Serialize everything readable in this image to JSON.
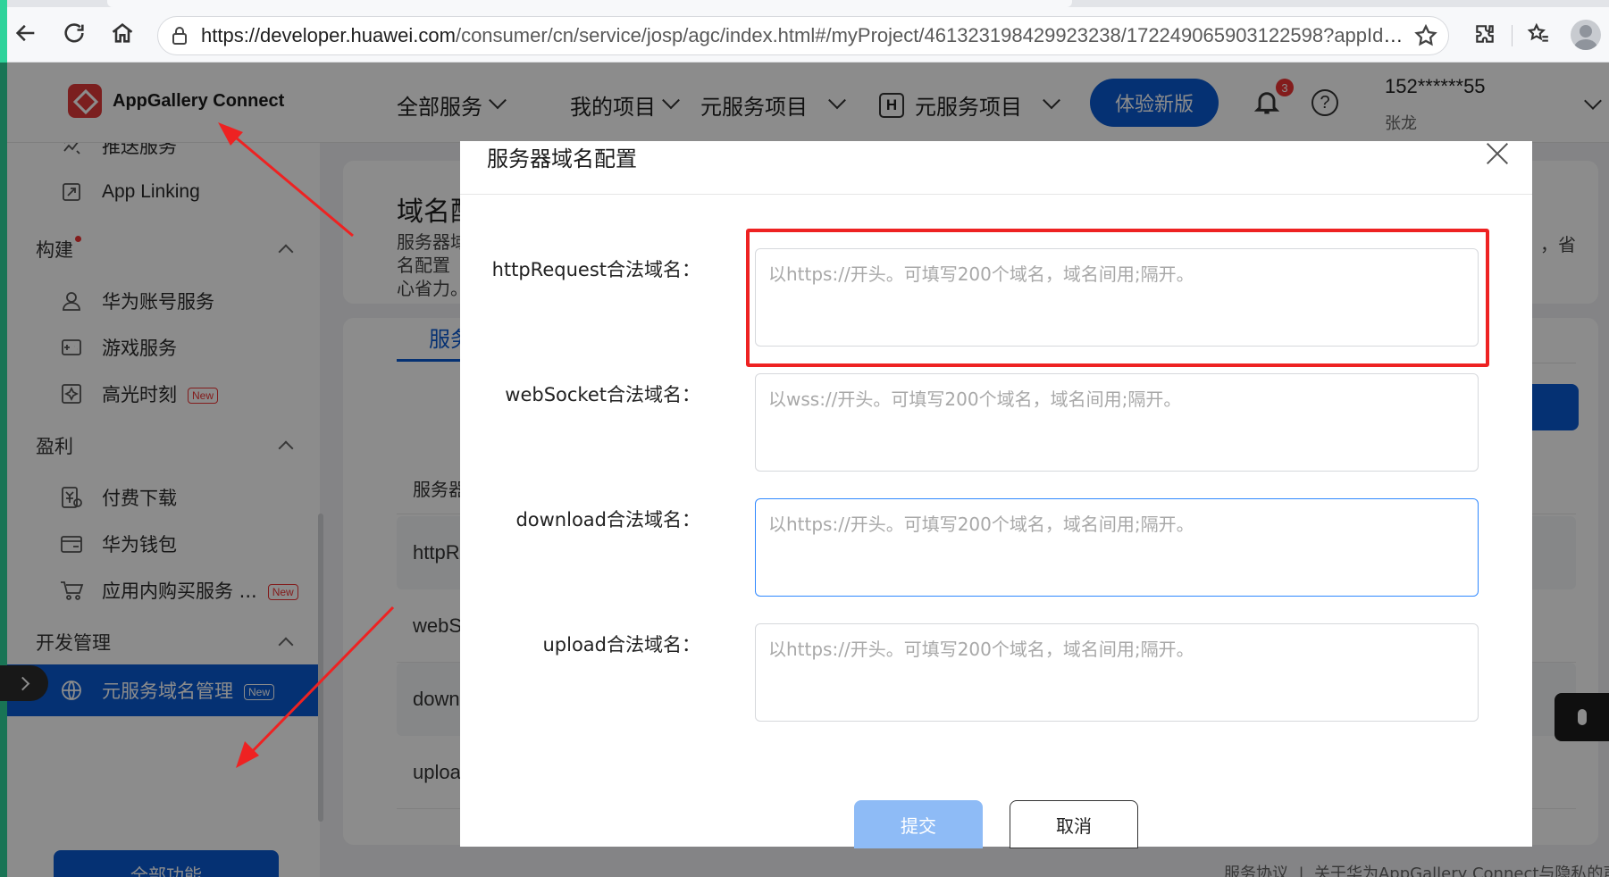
{
  "browser": {
    "url_host": "https://developer.huawei.com",
    "url_path": "/consumer/cn/service/josp/agc/index.html#/myProject/461323198429923238/172249065903122598?appId=6917..."
  },
  "header": {
    "logo_text": "AppGallery Connect",
    "nav": {
      "all_services": "全部服务",
      "my_projects": "我的项目",
      "atomic_projects": "元服务项目",
      "h_box": "H",
      "atomic_projects_2": "元服务项目"
    },
    "try_new": "体验新版",
    "notification_count": "3",
    "help": "?",
    "user_phone": "152******55",
    "user_name": "张龙"
  },
  "sidebar": {
    "items_top": [
      {
        "label": "推送服务",
        "icon": "push-icon"
      },
      {
        "label": "App Linking",
        "icon": "link-icon"
      }
    ],
    "group_build": "构建",
    "items_build": [
      {
        "label": "华为账号服务",
        "icon": "user-icon"
      },
      {
        "label": "游戏服务",
        "icon": "game-icon"
      },
      {
        "label": "高光时刻",
        "icon": "sparkle-icon",
        "badge": "New"
      }
    ],
    "group_profit": "盈利",
    "items_profit": [
      {
        "label": "付费下载",
        "icon": "paid-download-icon"
      },
      {
        "label": "华为钱包",
        "icon": "wallet-icon"
      },
      {
        "label": "应用内购买服务 ...",
        "icon": "cart-icon",
        "badge": "New"
      }
    ],
    "group_dev": "开发管理",
    "active_item": {
      "label": "元服务域名管理",
      "icon": "www-icon",
      "badge": "New"
    },
    "all_functions": "全部功能"
  },
  "main": {
    "title": "域名配",
    "desc": "服务器域名配置 心省力。",
    "desc_right": "，省",
    "tab": "服务",
    "table_head": "服务器",
    "rows": [
      "httpR",
      "webS",
      "down",
      "uploa"
    ],
    "footer_link_1": "服务协议",
    "footer_sep": "|",
    "footer_link_2": "关于华为AppGallery Connect与隐私的声"
  },
  "modal": {
    "title": "服务器域名配置",
    "fields": [
      {
        "label": "httpRequest合法域名：",
        "placeholder": "以https://开头。可填写200个域名，域名间用;隔开。",
        "value": ""
      },
      {
        "label": "webSocket合法域名：",
        "placeholder": "以wss://开头。可填写200个域名，域名间用;隔开。",
        "value": ""
      },
      {
        "label": "download合法域名：",
        "placeholder": "以https://开头。可填写200个域名，域名间用;隔开。",
        "value": ""
      },
      {
        "label": "upload合法域名：",
        "placeholder": "以https://开头。可填写200个域名，域名间用;隔开。",
        "value": ""
      }
    ],
    "submit": "提交",
    "cancel": "取消"
  },
  "colors": {
    "brand_blue": "#0a59d1",
    "annotation_red": "#ee2222",
    "submit_disabled": "#8ebbf6"
  }
}
